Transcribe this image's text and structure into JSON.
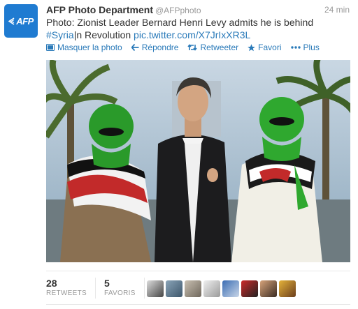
{
  "author": {
    "name": "AFP Photo Department",
    "handle": "@AFPphoto",
    "avatar_logo": "AFP",
    "avatar_color": "#1f7bd1"
  },
  "timestamp": "24 min",
  "tweet": {
    "text_line1": "Photo: Zionist Leader Bernard Henri Levy admits he is behind",
    "hashtag": "#Syria",
    "text_after_hashtag": "|n Revolution ",
    "link": "pic.twitter.com/X7JrIxXR3L"
  },
  "actions": [
    {
      "label": "Masquer la photo",
      "icon": "photo-icon"
    },
    {
      "label": "Répondre",
      "icon": "reply-icon"
    },
    {
      "label": "Retweeter",
      "icon": "retweet-icon"
    },
    {
      "label": "Favori",
      "icon": "star-icon"
    },
    {
      "label": "Plus",
      "icon": "more-icon"
    }
  ],
  "stats": {
    "retweets": {
      "value": "28",
      "label": "RETWEETS"
    },
    "favorites": {
      "value": "5",
      "label": "FAVORIS"
    }
  },
  "colors": {
    "link": "#2a7ab9",
    "muted": "#999999",
    "text": "#333333"
  }
}
